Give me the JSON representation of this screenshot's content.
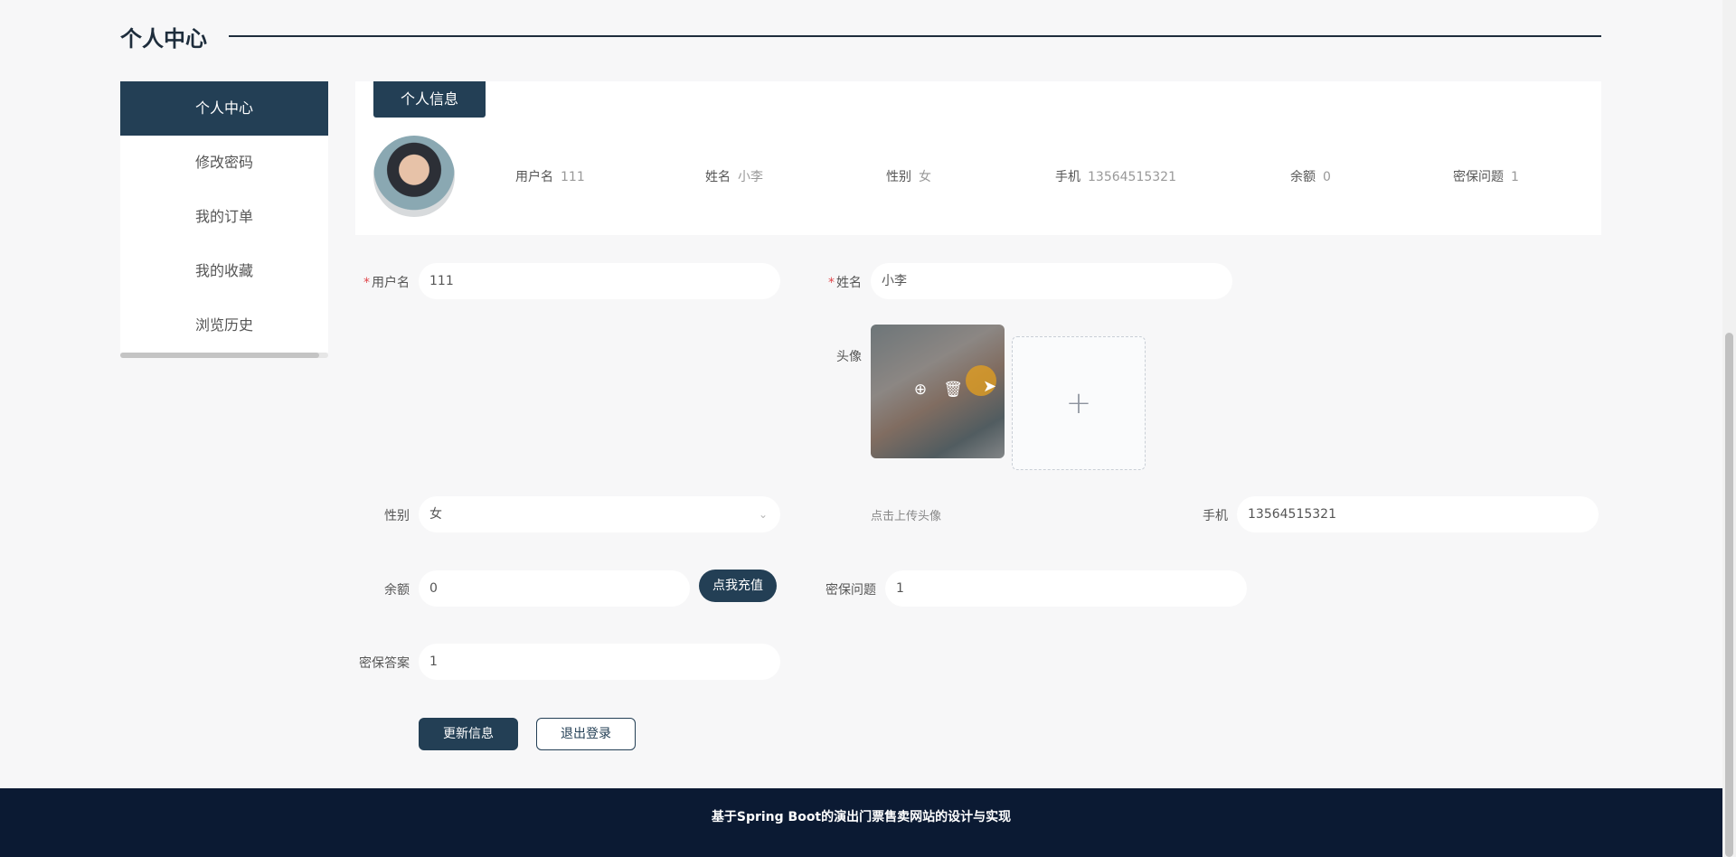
{
  "page": {
    "title": "个人中心"
  },
  "sidebar": {
    "items": [
      {
        "label": "个人中心"
      },
      {
        "label": "修改密码"
      },
      {
        "label": "我的订单"
      },
      {
        "label": "我的收藏"
      },
      {
        "label": "浏览历史"
      }
    ]
  },
  "info_card": {
    "tab": "个人信息",
    "items": [
      {
        "label": "用户名",
        "value": "111"
      },
      {
        "label": "姓名",
        "value": "小李"
      },
      {
        "label": "性别",
        "value": "女"
      },
      {
        "label": "手机",
        "value": "13564515321"
      },
      {
        "label": "余额",
        "value": "0"
      },
      {
        "label": "密保问题",
        "value": "1"
      }
    ]
  },
  "form": {
    "username": {
      "label": "用户名",
      "value": "111",
      "required": "*"
    },
    "name": {
      "label": "姓名",
      "value": "小李",
      "required": "*"
    },
    "avatar": {
      "label": "头像",
      "hint": "点击上传头像"
    },
    "gender": {
      "label": "性别",
      "value": "女"
    },
    "phone": {
      "label": "手机",
      "value": "13564515321"
    },
    "balance": {
      "label": "余额",
      "value": "0",
      "recharge": "点我充值"
    },
    "security_question": {
      "label": "密保问题",
      "value": "1"
    },
    "security_answer": {
      "label": "密保答案",
      "value": "1"
    },
    "update_button": "更新信息",
    "logout_button": "退出登录"
  },
  "footer": {
    "text": "基于Spring Boot的演出门票售卖网站的设计与实现"
  },
  "icons": {
    "zoom": "zoom-in-icon",
    "delete": "trash-icon",
    "plus": "plus-icon",
    "chevron": "chevron-down-icon"
  },
  "colors": {
    "primary": "#233f55",
    "footer": "#0b1a33",
    "required": "#e0464b"
  }
}
